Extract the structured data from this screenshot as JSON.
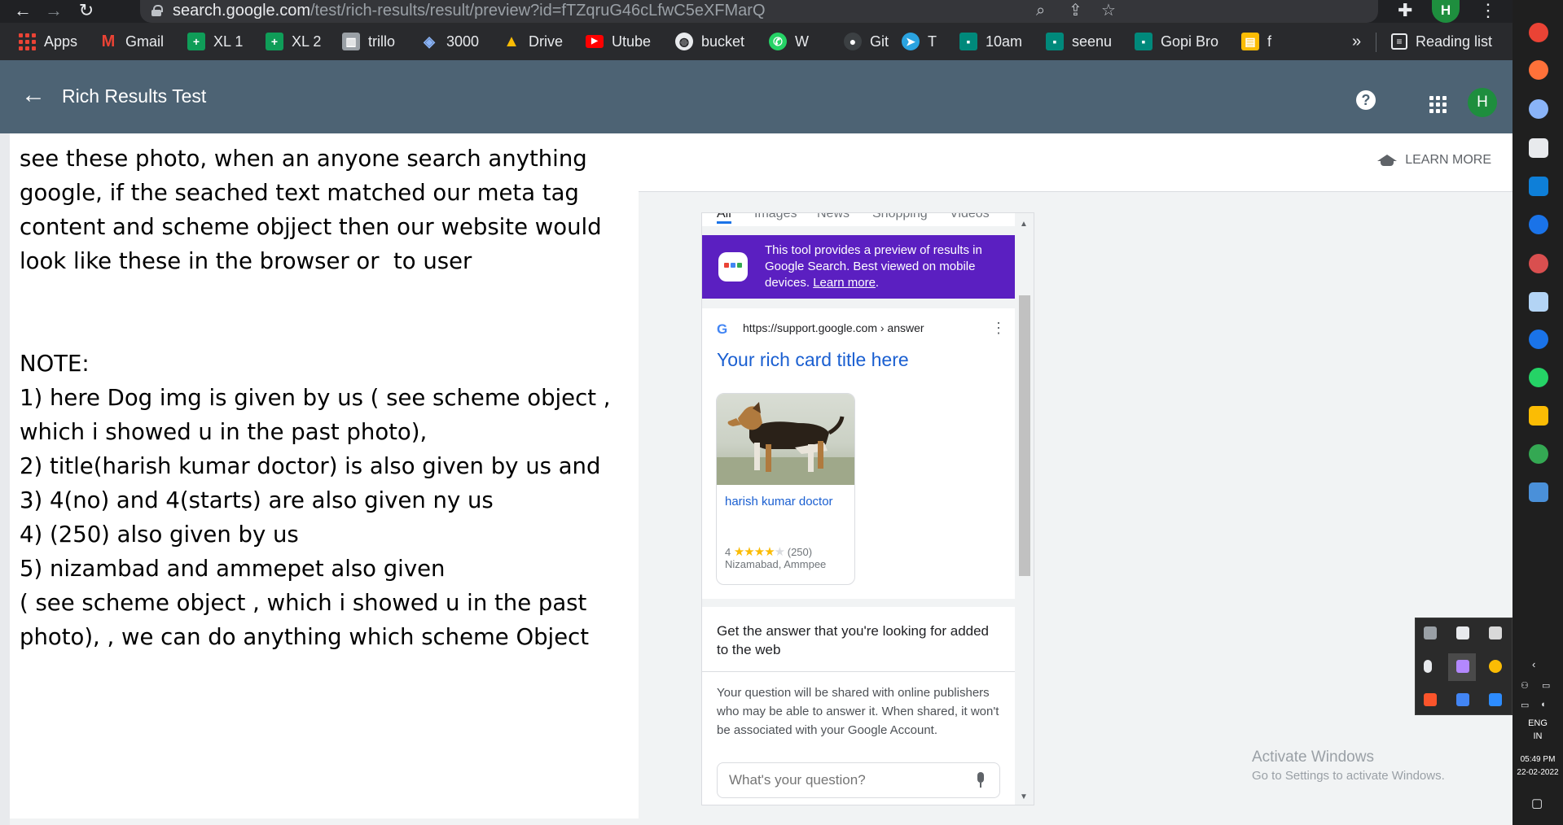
{
  "browser": {
    "url_host": "search.google.com",
    "url_path": "/test/rich-results/result/preview?id=fTZqruG46cLfwC5eXFMarQ",
    "profile_initial": "H",
    "bookmarks": [
      {
        "label": "Apps",
        "icon": "apps-grid-icon",
        "color": "#ea4335"
      },
      {
        "label": "Gmail",
        "icon": "gmail-icon",
        "color": "#ea4335"
      },
      {
        "label": "XL 1",
        "icon": "sheets-icon",
        "color": "#0f9d58"
      },
      {
        "label": "XL 2",
        "icon": "sheets-icon",
        "color": "#0f9d58"
      },
      {
        "label": "trillo",
        "icon": "trello-icon",
        "color": "#9aa0a6"
      },
      {
        "label": "3000",
        "icon": "localhost-icon",
        "color": "#8ab4f8"
      },
      {
        "label": "Drive",
        "icon": "drive-icon",
        "color": "#fbbc04"
      },
      {
        "label": "Utube",
        "icon": "youtube-icon",
        "color": "#ff0000"
      },
      {
        "label": "bucket",
        "icon": "globe-icon",
        "color": "#e8eaed"
      },
      {
        "label": "W",
        "icon": "whatsapp-icon",
        "color": "#25d366"
      },
      {
        "label": "Git",
        "icon": "github-icon",
        "color": "#3c4043"
      },
      {
        "label": "T",
        "icon": "telegram-icon",
        "color": "#2aa3e0"
      },
      {
        "label": "10am",
        "icon": "meet-icon",
        "color": "#00897b"
      },
      {
        "label": "seenu",
        "icon": "meet-icon",
        "color": "#00897b"
      },
      {
        "label": "Gopi Bro",
        "icon": "meet-icon",
        "color": "#00897b"
      },
      {
        "label": "f",
        "icon": "folder-icon",
        "color": "#fbbc04"
      }
    ],
    "overflow_label": "»",
    "reading_list_label": "Reading list"
  },
  "header": {
    "title": "Rich Results Test",
    "help_label": "?",
    "avatar_initial": "H"
  },
  "toolbar": {
    "learn_more_label": "LEARN MORE"
  },
  "note": {
    "text": "see these photo, when an anyone search anything google, if the seached text matched our meta tag content and scheme objject then our website would look like these in the browser or  to user\n\n\nNOTE:\n1) here Dog img is given by us ( see scheme object , which i showed u in the past photo),\n2) title(harish kumar doctor) is also given by us and\n3) 4(no) and 4(starts) are also given ny us\n4) (250) also given by us\n5) nizambad and ammepet also given\n( see scheme object , which i showed u in the past photo), , we can do anything which scheme Object"
  },
  "preview": {
    "tabs": [
      "All",
      "Images",
      "News",
      "Shopping",
      "Videos"
    ],
    "banner": {
      "text": "This tool provides a preview of results in Google Search. Best viewed on mobile devices.",
      "link": "Learn more",
      "link_suffix": "."
    },
    "result": {
      "logo": "G",
      "url": "https://support.google.com › answer",
      "title": "Your rich card title here",
      "card": {
        "name": "harish kumar doctor",
        "rating_value": "4",
        "stars_filled": 4,
        "stars_total": 5,
        "review_count": "(250)",
        "location": "Nizamabad, Ammpee"
      }
    },
    "qa": {
      "title": "Get the answer that you're looking for added to the web",
      "body": "Your question will be shared with online publishers who may be able to answer it. When shared, it won't be associated with your Google Account.",
      "placeholder": "What's your question?"
    }
  },
  "windows": {
    "activate_title": "Activate Windows",
    "activate_subtitle": "Go to Settings to activate Windows.",
    "language": "ENG",
    "region": "IN",
    "time": "05:49 PM",
    "date": "22-02-2022"
  },
  "colors": {
    "header_bg": "#4d6374",
    "banner_bg": "#5b1fc1",
    "link_blue": "#1a5fd1",
    "star": "#fbbc04"
  }
}
